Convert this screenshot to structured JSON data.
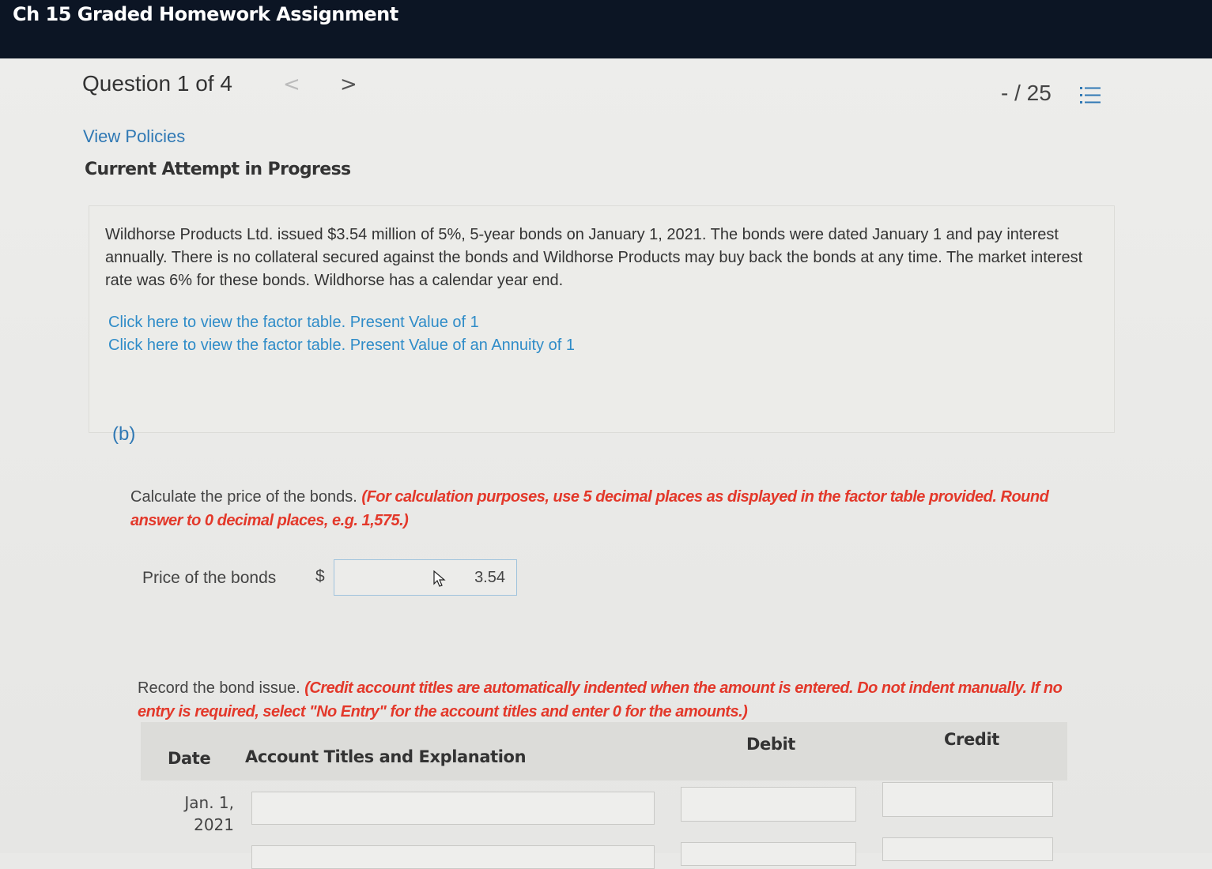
{
  "header": {
    "title": "Ch 15 Graded Homework Assignment"
  },
  "question": {
    "title": "Question 1 of 4",
    "prev_glyph": "<",
    "next_glyph": ">",
    "score": "- / 25",
    "list_icon": "list-icon"
  },
  "links": {
    "view_policies": "View Policies"
  },
  "status": {
    "attempt": "Current Attempt in Progress"
  },
  "problem": {
    "text": "Wildhorse Products Ltd. issued $3.54 million of 5%, 5-year bonds on January 1, 2021. The bonds were dated January 1 and pay interest annually. There is no collateral secured against the bonds and Wildhorse Products may buy back the bonds at any time. The market interest rate was 6% for these bonds. Wildhorse has a calendar year end.",
    "factor_link_1": "Click here to view the factor table. Present Value of 1",
    "factor_link_2": "Click here to view the factor table. Present Value of an Annuity of 1"
  },
  "part_b": {
    "label": "(b)",
    "calc_instruction": "Calculate the price of the bonds.",
    "calc_note": "(For calculation purposes, use 5 decimal places as displayed in the factor table provided. Round answer to 0 decimal places, e.g. 1,575.)",
    "price_label": "Price of the bonds",
    "currency": "$",
    "price_value": "3.54",
    "record_instruction": "Record the bond issue.",
    "record_note": "(Credit account titles are automatically indented when the amount is entered. Do not indent manually. If no entry is required, select \"No Entry\" for the account titles and enter 0 for the amounts.)"
  },
  "journal": {
    "headers": {
      "date": "Date",
      "account": "Account Titles and Explanation",
      "debit": "Debit",
      "credit": "Credit"
    },
    "rows": [
      {
        "date_line1": "Jan. 1,",
        "date_line2": "2021",
        "account": "",
        "debit": "",
        "credit": ""
      }
    ]
  },
  "colors": {
    "topbar": "#0c1524",
    "link": "#2f78b4",
    "note_red": "#e3382a"
  }
}
